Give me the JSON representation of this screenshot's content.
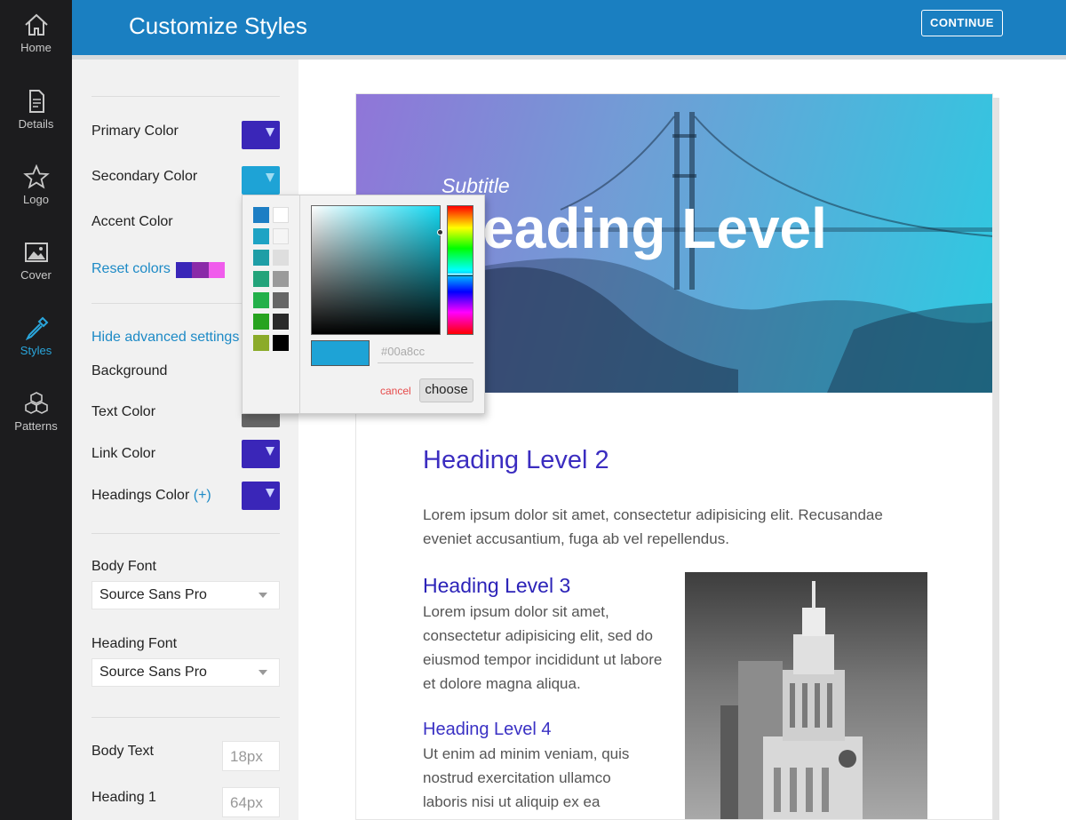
{
  "nav": {
    "items": [
      {
        "label": "Home",
        "icon": "home-icon"
      },
      {
        "label": "Details",
        "icon": "document-icon"
      },
      {
        "label": "Logo",
        "icon": "star-icon"
      },
      {
        "label": "Cover",
        "icon": "image-icon"
      },
      {
        "label": "Styles",
        "icon": "eyedropper-icon",
        "active": true
      },
      {
        "label": "Patterns",
        "icon": "cubes-icon"
      }
    ]
  },
  "header": {
    "title": "Customize Styles",
    "continue_label": "CONTINUE",
    "color": "#1a7fc1"
  },
  "settings": {
    "primary_color": {
      "label": "Primary Color",
      "value": "#3a26b8"
    },
    "secondary_color": {
      "label": "Secondary Color",
      "value": "#1ea3d6"
    },
    "accent_color": {
      "label": "Accent Color"
    },
    "reset_colors": {
      "label": "Reset colors",
      "swatches": [
        "#3a26b8",
        "#8a2aa8",
        "#f05cec"
      ]
    },
    "advanced_toggle": "Hide advanced settings",
    "background": {
      "label": "Background"
    },
    "text_color": {
      "label": "Text Color",
      "value": "#666666"
    },
    "link_color": {
      "label": "Link Color",
      "value": "#3a26b8"
    },
    "headings_color": {
      "label": "Headings Color",
      "suffix": "(+)",
      "value": "#3a26b8"
    },
    "body_font": {
      "label": "Body Font",
      "value": "Source Sans Pro"
    },
    "heading_font": {
      "label": "Heading Font",
      "value": "Source Sans Pro"
    },
    "body_text": {
      "label": "Body Text",
      "value": "18px"
    },
    "heading_1": {
      "label": "Heading 1",
      "value": "64px"
    }
  },
  "color_picker": {
    "palette": [
      [
        "#1d7ec4",
        "#ffffff"
      ],
      [
        "#1ea3c4",
        "#f5f5f5"
      ],
      [
        "#1f9ea6",
        "#dedede"
      ],
      [
        "#23a37a",
        "#9a9a9a"
      ],
      [
        "#23b04a",
        "#666666"
      ],
      [
        "#27a31f",
        "#2a2a2a"
      ],
      [
        "#8bab2a",
        "#000000"
      ]
    ],
    "selected_color": "#1ea3d6",
    "hex_placeholder": "#00a8cc",
    "cancel_label": "cancel",
    "choose_label": "choose"
  },
  "preview": {
    "subtitle": "Subtitle",
    "heading": "Heading Level",
    "h2": "Heading Level 2",
    "intro": "Lorem ipsum dolor sit amet, consectetur adipisicing elit. Recusandae eveniet accusantium, fuga ab vel repellendus.",
    "h3": "Heading Level 3",
    "paragraph_2": "Lorem ipsum dolor sit amet, consectetur adipisicing elit, sed do eiusmod tempor incididunt ut labore et dolore magna aliqua.",
    "h4": "Heading Level 4",
    "paragraph_3": "Ut enim ad minim veniam, quis nostrud exercitation ullamco laboris nisi ut aliquip ex ea commodo consequat. Duis aute"
  }
}
